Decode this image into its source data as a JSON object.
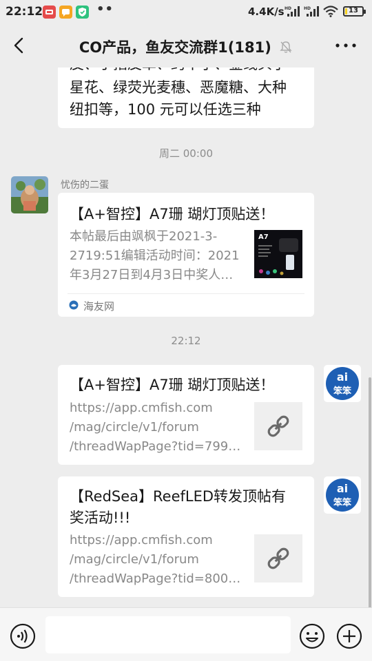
{
  "status_bar": {
    "time": "22:12",
    "dots": "••",
    "net_speed": "4.4K/s",
    "signal_label": "HD",
    "battery": "13",
    "battery_fraction": 0.13
  },
  "header": {
    "title": "CO产品，鱼友交流群1(181)",
    "back_icon": "chevron-left",
    "mute_icon": "bell-off",
    "more_icon": "ellipsis"
  },
  "messages": [
    {
      "type": "text",
      "direction": "incoming",
      "lines": [
        "皮、于指皮革、约十子、金线头子",
        "星花、绿荧光麦穗、恶魔糖、大种",
        "纽扣等，100 元可以任选三种"
      ]
    },
    {
      "type": "timestamp",
      "text": "周二 00:00"
    },
    {
      "type": "card",
      "direction": "incoming",
      "sender": "忧伤的二蛋",
      "title": "【A+智控】A7珊 瑚灯顶贴送！",
      "desc_lines": [
        "本帖最后由飒枫于2021-3-",
        "2719:51编辑活动时间：2021",
        "年3月27日到4月3日中奖人…"
      ],
      "thumb_label": "A7",
      "source": "海友网"
    },
    {
      "type": "timestamp",
      "text": "22:12"
    },
    {
      "type": "link",
      "direction": "outgoing",
      "title_lines": [
        "【A+智控】A7珊 瑚灯顶贴送！"
      ],
      "url_lines": [
        "https://app.cmfish.com",
        "/mag/circle/v1/forum",
        "/threadWapPage?tid=799…"
      ],
      "avatar_label": "ai",
      "avatar_sub": "笨笨"
    },
    {
      "type": "link",
      "direction": "outgoing",
      "title_lines": [
        "【RedSea】ReefLED转发顶帖有",
        "奖活动!!!"
      ],
      "url_lines": [
        "https://app.cmfish.com",
        "/mag/circle/v1/forum",
        "/threadWapPage?tid=800…"
      ],
      "avatar_label": "ai",
      "avatar_sub": "笨笨"
    }
  ],
  "input_bar": {
    "voice_icon": "voice",
    "input_value": "",
    "emoji_icon": "emoji",
    "plus_icon": "plus"
  },
  "colors": {
    "background": "#ededed",
    "bubble": "#ffffff",
    "meta_text": "#8c8c8c",
    "brand_blue": "#1e5fb4"
  }
}
